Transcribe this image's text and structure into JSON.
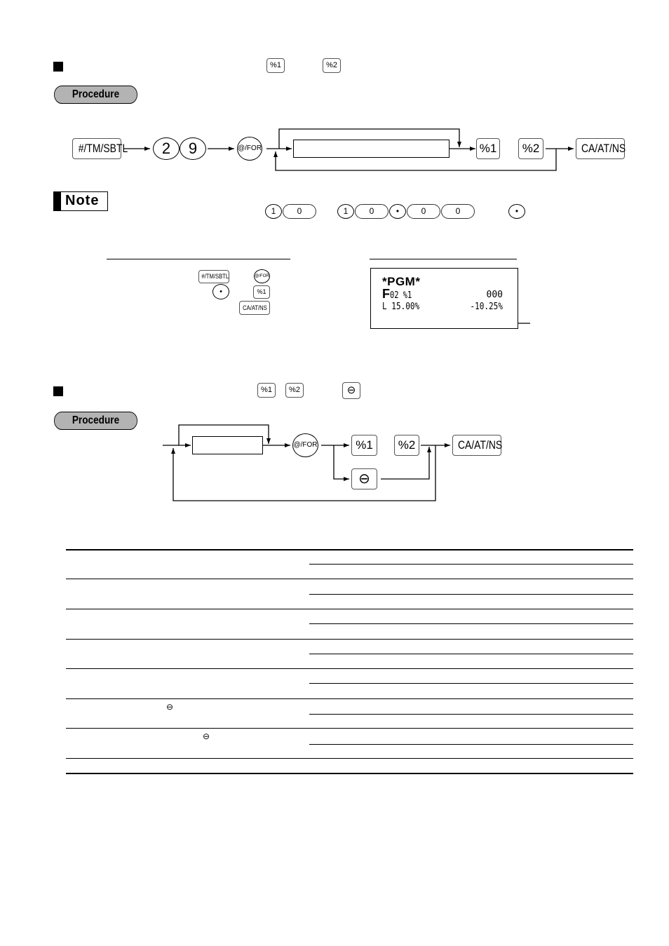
{
  "section1": {
    "keys": [
      "%1",
      "%2"
    ],
    "procedure_label": "Procedure",
    "flow": {
      "start_key": "#/TM/SBTL",
      "digits": [
        "2",
        "9"
      ],
      "for_key": "@/FOR",
      "input_box": "",
      "pct_keys": [
        "%1",
        "%2"
      ],
      "end_key": "CA/AT/NS"
    }
  },
  "note": {
    "label": "Note",
    "example_short": [
      "1",
      "0"
    ],
    "example_long": [
      "1",
      "0",
      "•",
      "0",
      "0"
    ],
    "decimal_key": "•"
  },
  "example": {
    "key_operation_keys": {
      "row1": [
        "#/TM/SBTL",
        "@/FOR"
      ],
      "row2": [
        "•",
        "%1"
      ],
      "row3": [
        "CA/AT/NS"
      ]
    },
    "print": {
      "line1": "*PGM*",
      "line2_left_bold": "F",
      "line2_left": "02 %1",
      "line2_right": "000",
      "line3_left": "L 15.00%",
      "line3_right": "-10.25%"
    }
  },
  "section2": {
    "keys": [
      "%1",
      "%2",
      "⊖"
    ],
    "procedure_label": "Procedure",
    "flow": {
      "input_box": "",
      "for_key": "@/FOR",
      "pct_keys": [
        "%1",
        "%2"
      ],
      "minus_key": "⊖",
      "end_key": "CA/AT/NS"
    }
  },
  "table": {
    "rows": [
      {
        "left": "",
        "right": [
          "",
          ""
        ]
      },
      {
        "left": "",
        "right": [
          "",
          ""
        ]
      },
      {
        "left": "",
        "right": [
          "",
          ""
        ]
      },
      {
        "left": "",
        "right": [
          "",
          ""
        ]
      },
      {
        "left": "",
        "right": [
          "",
          ""
        ]
      },
      {
        "left": "",
        "left_icon": "⊖",
        "right": [
          "",
          ""
        ]
      },
      {
        "left": "",
        "left_icon": "⊖",
        "right": [
          "",
          ""
        ]
      },
      {
        "left": "",
        "right": [
          ""
        ]
      }
    ]
  }
}
